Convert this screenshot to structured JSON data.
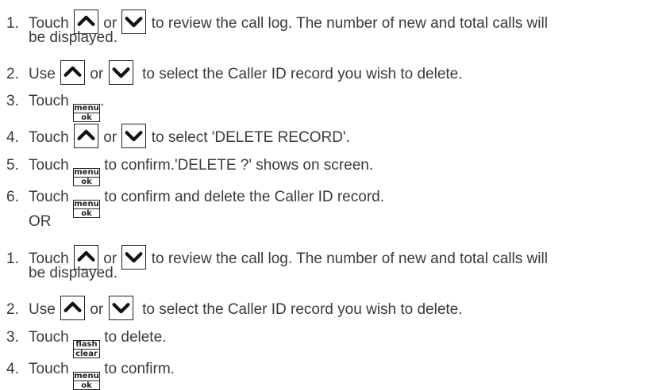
{
  "keys": {
    "up": "up-arrow-icon",
    "down": "down-arrow-icon",
    "menu_top": "menu",
    "menu_bottom": "ok",
    "flash_top": "flash",
    "flash_bottom": "clear"
  },
  "section1": {
    "steps": [
      {
        "num": "1.",
        "t1": "Touch",
        "t2": "or",
        "t3": "to review the call log. The number of new and total calls will",
        "t4": "be displayed."
      },
      {
        "num": "2.",
        "t1": "Use",
        "t2": "or",
        "t3": "to select the Caller ID record you wish to delete."
      },
      {
        "num": "3.",
        "t1": "Touch",
        "t2": "."
      },
      {
        "num": "4.",
        "t1": "Touch",
        "t2": "or",
        "t3": "to select 'DELETE RECORD'."
      },
      {
        "num": "5.",
        "t1": "Touch",
        "t2": "to confirm.'DELETE ?' shows on screen."
      },
      {
        "num": "6.",
        "t1": "Touch",
        "t2": "to confirm and delete the Caller ID record."
      }
    ]
  },
  "or_label": "OR",
  "section2": {
    "steps": [
      {
        "num": "1.",
        "t1": "Touch",
        "t2": "or",
        "t3": "to review the call log. The number of new and total calls will",
        "t4": "be displayed."
      },
      {
        "num": "2.",
        "t1": "Use",
        "t2": "or",
        "t3": "to select the Caller ID record you wish to delete."
      },
      {
        "num": "3.",
        "t1": "Touch",
        "t2": "to delete."
      },
      {
        "num": "4.",
        "t1": "Touch",
        "t2": "to confirm."
      }
    ]
  }
}
